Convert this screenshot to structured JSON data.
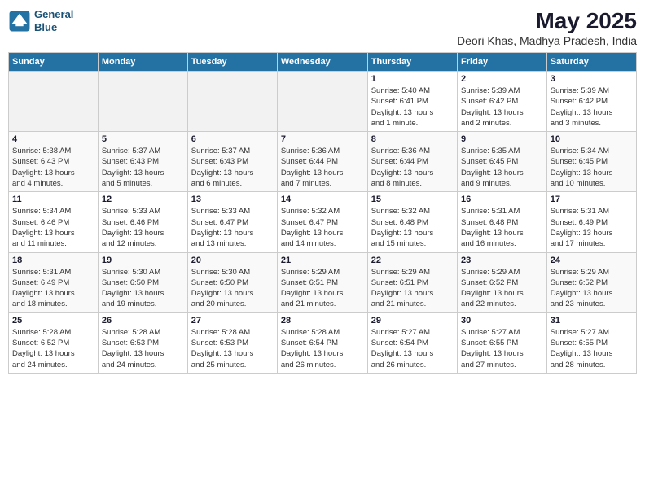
{
  "header": {
    "logo_line1": "General",
    "logo_line2": "Blue",
    "month": "May 2025",
    "location": "Deori Khas, Madhya Pradesh, India"
  },
  "weekdays": [
    "Sunday",
    "Monday",
    "Tuesday",
    "Wednesday",
    "Thursday",
    "Friday",
    "Saturday"
  ],
  "weeks": [
    [
      {
        "day": "",
        "info": ""
      },
      {
        "day": "",
        "info": ""
      },
      {
        "day": "",
        "info": ""
      },
      {
        "day": "",
        "info": ""
      },
      {
        "day": "1",
        "info": "Sunrise: 5:40 AM\nSunset: 6:41 PM\nDaylight: 13 hours\nand 1 minute."
      },
      {
        "day": "2",
        "info": "Sunrise: 5:39 AM\nSunset: 6:42 PM\nDaylight: 13 hours\nand 2 minutes."
      },
      {
        "day": "3",
        "info": "Sunrise: 5:39 AM\nSunset: 6:42 PM\nDaylight: 13 hours\nand 3 minutes."
      }
    ],
    [
      {
        "day": "4",
        "info": "Sunrise: 5:38 AM\nSunset: 6:43 PM\nDaylight: 13 hours\nand 4 minutes."
      },
      {
        "day": "5",
        "info": "Sunrise: 5:37 AM\nSunset: 6:43 PM\nDaylight: 13 hours\nand 5 minutes."
      },
      {
        "day": "6",
        "info": "Sunrise: 5:37 AM\nSunset: 6:43 PM\nDaylight: 13 hours\nand 6 minutes."
      },
      {
        "day": "7",
        "info": "Sunrise: 5:36 AM\nSunset: 6:44 PM\nDaylight: 13 hours\nand 7 minutes."
      },
      {
        "day": "8",
        "info": "Sunrise: 5:36 AM\nSunset: 6:44 PM\nDaylight: 13 hours\nand 8 minutes."
      },
      {
        "day": "9",
        "info": "Sunrise: 5:35 AM\nSunset: 6:45 PM\nDaylight: 13 hours\nand 9 minutes."
      },
      {
        "day": "10",
        "info": "Sunrise: 5:34 AM\nSunset: 6:45 PM\nDaylight: 13 hours\nand 10 minutes."
      }
    ],
    [
      {
        "day": "11",
        "info": "Sunrise: 5:34 AM\nSunset: 6:46 PM\nDaylight: 13 hours\nand 11 minutes."
      },
      {
        "day": "12",
        "info": "Sunrise: 5:33 AM\nSunset: 6:46 PM\nDaylight: 13 hours\nand 12 minutes."
      },
      {
        "day": "13",
        "info": "Sunrise: 5:33 AM\nSunset: 6:47 PM\nDaylight: 13 hours\nand 13 minutes."
      },
      {
        "day": "14",
        "info": "Sunrise: 5:32 AM\nSunset: 6:47 PM\nDaylight: 13 hours\nand 14 minutes."
      },
      {
        "day": "15",
        "info": "Sunrise: 5:32 AM\nSunset: 6:48 PM\nDaylight: 13 hours\nand 15 minutes."
      },
      {
        "day": "16",
        "info": "Sunrise: 5:31 AM\nSunset: 6:48 PM\nDaylight: 13 hours\nand 16 minutes."
      },
      {
        "day": "17",
        "info": "Sunrise: 5:31 AM\nSunset: 6:49 PM\nDaylight: 13 hours\nand 17 minutes."
      }
    ],
    [
      {
        "day": "18",
        "info": "Sunrise: 5:31 AM\nSunset: 6:49 PM\nDaylight: 13 hours\nand 18 minutes."
      },
      {
        "day": "19",
        "info": "Sunrise: 5:30 AM\nSunset: 6:50 PM\nDaylight: 13 hours\nand 19 minutes."
      },
      {
        "day": "20",
        "info": "Sunrise: 5:30 AM\nSunset: 6:50 PM\nDaylight: 13 hours\nand 20 minutes."
      },
      {
        "day": "21",
        "info": "Sunrise: 5:29 AM\nSunset: 6:51 PM\nDaylight: 13 hours\nand 21 minutes."
      },
      {
        "day": "22",
        "info": "Sunrise: 5:29 AM\nSunset: 6:51 PM\nDaylight: 13 hours\nand 21 minutes."
      },
      {
        "day": "23",
        "info": "Sunrise: 5:29 AM\nSunset: 6:52 PM\nDaylight: 13 hours\nand 22 minutes."
      },
      {
        "day": "24",
        "info": "Sunrise: 5:29 AM\nSunset: 6:52 PM\nDaylight: 13 hours\nand 23 minutes."
      }
    ],
    [
      {
        "day": "25",
        "info": "Sunrise: 5:28 AM\nSunset: 6:52 PM\nDaylight: 13 hours\nand 24 minutes."
      },
      {
        "day": "26",
        "info": "Sunrise: 5:28 AM\nSunset: 6:53 PM\nDaylight: 13 hours\nand 24 minutes."
      },
      {
        "day": "27",
        "info": "Sunrise: 5:28 AM\nSunset: 6:53 PM\nDaylight: 13 hours\nand 25 minutes."
      },
      {
        "day": "28",
        "info": "Sunrise: 5:28 AM\nSunset: 6:54 PM\nDaylight: 13 hours\nand 26 minutes."
      },
      {
        "day": "29",
        "info": "Sunrise: 5:27 AM\nSunset: 6:54 PM\nDaylight: 13 hours\nand 26 minutes."
      },
      {
        "day": "30",
        "info": "Sunrise: 5:27 AM\nSunset: 6:55 PM\nDaylight: 13 hours\nand 27 minutes."
      },
      {
        "day": "31",
        "info": "Sunrise: 5:27 AM\nSunset: 6:55 PM\nDaylight: 13 hours\nand 28 minutes."
      }
    ]
  ]
}
